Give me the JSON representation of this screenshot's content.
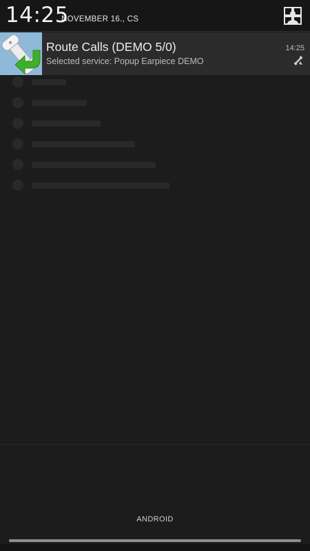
{
  "status_header": {
    "time": "14:25",
    "date": "NOVEMBER 16., CS"
  },
  "notification": {
    "title": "Route Calls (DEMO 5/0)",
    "text": "Selected service: Popup Earpiece DEMO",
    "time": "14:25",
    "app_icon": "phone-handset-with-green-arrow-icon",
    "small_icon": "handset-routing-icon"
  },
  "footer": {
    "carrier": "ANDROID"
  },
  "colors": {
    "background": "#1c1c1c",
    "header": "#161616",
    "notification_bg": "#2b2b2b",
    "icon_bg": "#8fb9d8",
    "arrow_green": "#3fae2a"
  }
}
